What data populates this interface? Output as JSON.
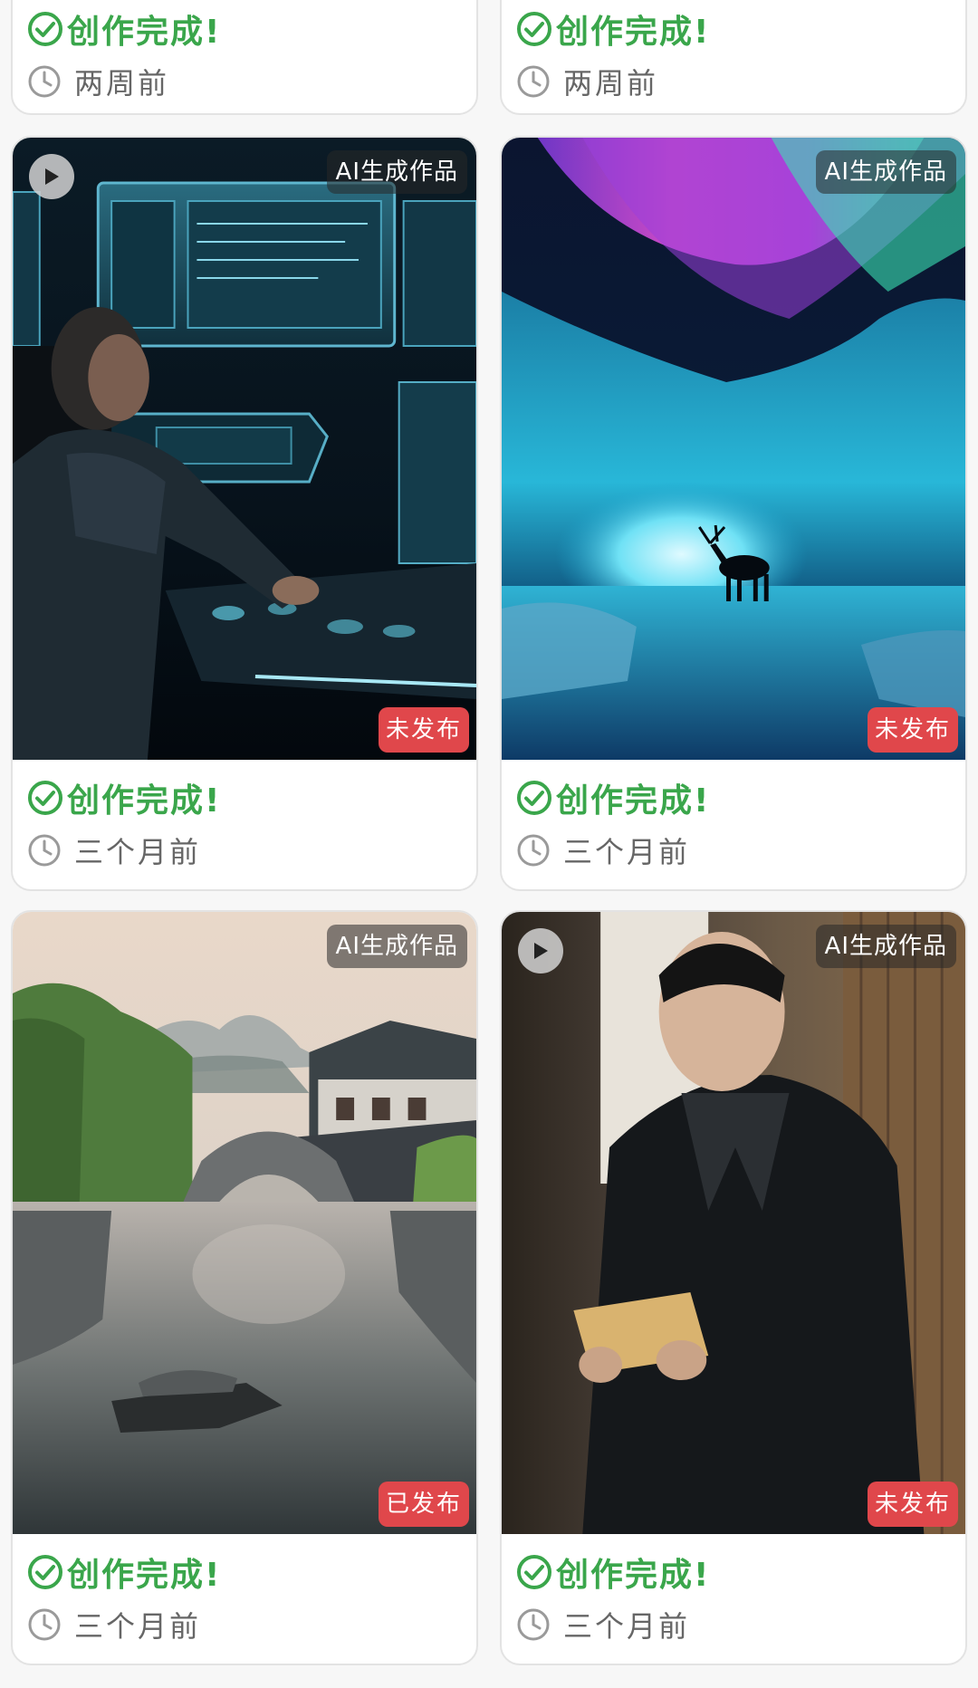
{
  "cards": [
    {
      "complete_label": "创作完成!",
      "time_label": "两周前"
    },
    {
      "complete_label": "创作完成!",
      "time_label": "两周前"
    },
    {
      "ai_label": "AI生成作品",
      "status_label": "未发布",
      "complete_label": "创作完成!",
      "time_label": "三个月前",
      "media_type": "video",
      "image_icon": "cyberpunk-operator-image"
    },
    {
      "ai_label": "AI生成作品",
      "status_label": "未发布",
      "complete_label": "创作完成!",
      "time_label": "三个月前",
      "media_type": "image",
      "image_icon": "aurora-ice-cave-elk-image"
    },
    {
      "ai_label": "AI生成作品",
      "status_label": "已发布",
      "complete_label": "创作完成!",
      "time_label": "三个月前",
      "media_type": "image",
      "image_icon": "water-town-bridge-image"
    },
    {
      "ai_label": "AI生成作品",
      "status_label": "未发布",
      "complete_label": "创作完成!",
      "time_label": "三个月前",
      "media_type": "video",
      "image_icon": "man-reading-letter-image"
    }
  ],
  "colors": {
    "success_green": "#3aa64b",
    "badge_red": "#e0474b",
    "muted_text": "#666666",
    "card_border": "#e3e3e3"
  },
  "icons": {
    "check": "check-circle-icon",
    "clock": "clock-icon",
    "play": "play-icon"
  }
}
